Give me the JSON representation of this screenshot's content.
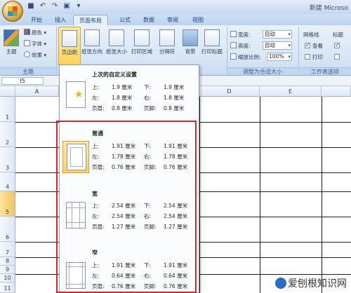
{
  "window": {
    "title": "新建 Microso"
  },
  "tabs": [
    "开始",
    "插入",
    "页面布局",
    "公式",
    "数据",
    "审阅",
    "视图"
  ],
  "active_tab": "页面布局",
  "ribbon": {
    "theme": {
      "label": "主题",
      "colors": "颜色",
      "fonts": "字体",
      "effects": "效果",
      "group": "主题"
    },
    "page_setup": {
      "margins": "页边距",
      "orientation": "纸张方向",
      "size": "纸张大小",
      "print_area": "打印区域",
      "breaks": "分隔符",
      "background": "背景",
      "print_titles": "打印标题"
    },
    "scale": {
      "width_label": "宽度:",
      "width_value": "自动",
      "height_label": "高度:",
      "height_value": "自动",
      "scale_label": "缩放比例:",
      "scale_value": "100%",
      "group": "调整为合适大小"
    },
    "sheet_options": {
      "gridlines": "网格线",
      "headings": "标题",
      "view": "查看",
      "print": "打印",
      "group": "工作表选项"
    }
  },
  "formula_bar": {
    "name_box": "I5"
  },
  "columns": [
    "A",
    "D",
    "E"
  ],
  "rows": [
    "1",
    "2",
    "3",
    "4",
    "5",
    "6",
    "7",
    "8",
    "9",
    "10",
    "11"
  ],
  "margins_menu": {
    "options": [
      {
        "title": "上次的自定义设置",
        "top": "1.9 厘米",
        "bottom": "1.9 厘米",
        "left": "1.8 厘米",
        "right": "1.8 厘米",
        "header": "0.8 厘米",
        "footer": "0.8 厘米"
      },
      {
        "title": "普通",
        "top": "1.91 厘米",
        "bottom": "1.91 厘米",
        "left": "1.78 厘米",
        "right": "1.78 厘米",
        "header": "0.76 厘米",
        "footer": "0.76 厘米"
      },
      {
        "title": "宽",
        "top": "2.54 厘米",
        "bottom": "2.54 厘米",
        "left": "2.54 厘米",
        "right": "2.54 厘米",
        "header": "1.27 厘米",
        "footer": "1.27 厘米"
      },
      {
        "title": "窄",
        "top": "1.91 厘米",
        "bottom": "1.91 厘米",
        "left": "0.64 厘米",
        "right": "0.64 厘米",
        "header": "0.76 厘米",
        "footer": "0.76 厘米"
      }
    ],
    "labels": {
      "top": "上:",
      "bottom": "下:",
      "left": "左:",
      "right": "右:",
      "header": "页眉:",
      "footer": "页脚:"
    }
  },
  "watermark": "爱刨根知识网"
}
